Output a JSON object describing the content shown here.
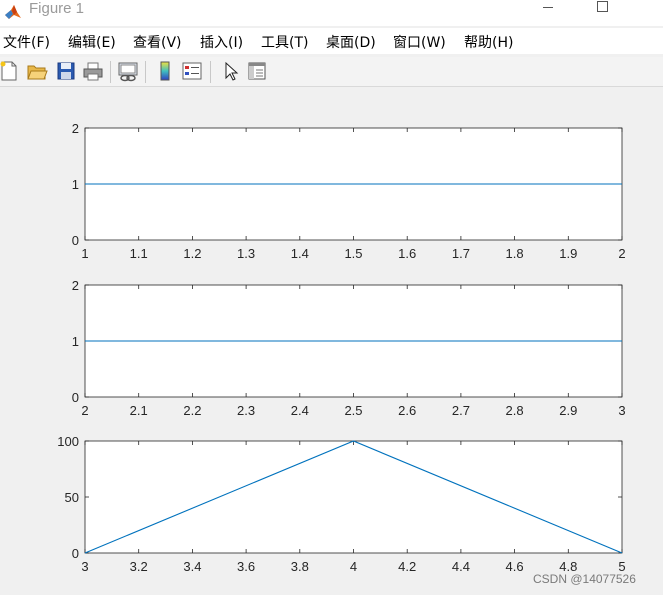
{
  "window": {
    "title": "Figure 1"
  },
  "menu": [
    "文件(F)",
    "编辑(E)",
    "查看(V)",
    "插入(I)",
    "工具(T)",
    "桌面(D)",
    "窗口(W)",
    "帮助(H)"
  ],
  "toolbar": {
    "icons": [
      "new-figure-icon",
      "open-file-icon",
      "save-icon",
      "print-icon",
      "link-plot-icon",
      "colorbar-icon",
      "legend-icon",
      "edit-plot-pointer-icon",
      "property-inspector-icon"
    ]
  },
  "colors": {
    "series": "#0072bd",
    "axes": "#262626",
    "plot_bg": "#ffffff",
    "figure_bg": "#f0f0f0"
  },
  "chart_data": [
    {
      "type": "line",
      "xlim": [
        1,
        2
      ],
      "ylim": [
        0,
        2
      ],
      "xticks": [
        "1",
        "1.1",
        "1.2",
        "1.3",
        "1.4",
        "1.5",
        "1.6",
        "1.7",
        "1.8",
        "1.9",
        "2"
      ],
      "yticks": [
        "0",
        "1",
        "2"
      ],
      "series": [
        {
          "x": [
            1,
            2
          ],
          "y": [
            1,
            1
          ]
        }
      ],
      "grid": false
    },
    {
      "type": "line",
      "xlim": [
        2,
        3
      ],
      "ylim": [
        0,
        2
      ],
      "xticks": [
        "2",
        "2.1",
        "2.2",
        "2.3",
        "2.4",
        "2.5",
        "2.6",
        "2.7",
        "2.8",
        "2.9",
        "3"
      ],
      "yticks": [
        "0",
        "1",
        "2"
      ],
      "series": [
        {
          "x": [
            2,
            3
          ],
          "y": [
            1,
            1
          ]
        }
      ],
      "grid": false
    },
    {
      "type": "line",
      "xlim": [
        3,
        5
      ],
      "ylim": [
        0,
        100
      ],
      "xticks": [
        "3",
        "3.2",
        "3.4",
        "3.6",
        "3.8",
        "4",
        "4.2",
        "4.4",
        "4.6",
        "4.8",
        "5"
      ],
      "yticks": [
        "0",
        "50",
        "100"
      ],
      "series": [
        {
          "x": [
            3,
            4,
            5
          ],
          "y": [
            0,
            100,
            0
          ]
        }
      ],
      "grid": false
    }
  ],
  "watermark": "CSDN @14077526"
}
